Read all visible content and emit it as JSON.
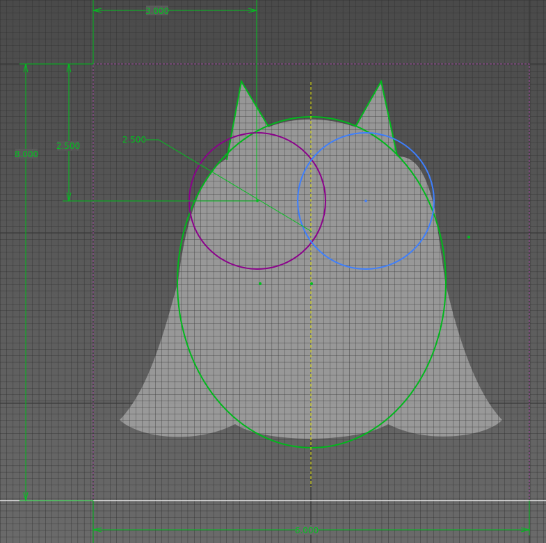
{
  "view": {
    "background_color": "#5a5a5a",
    "grid_color": "#2f2f2f",
    "sketch_line_color": "#00c21e",
    "silhouette_fill": "#9c9c9c"
  },
  "dimensions": {
    "width_top": "3.000",
    "height_left": "8.000",
    "height_inner": "2.500",
    "radius": "2.500",
    "width_bottom": "6.000"
  },
  "circles": {
    "left_color": "#8b008b",
    "right_color": "#3d7fff"
  },
  "centerline_color": "#e6e600"
}
